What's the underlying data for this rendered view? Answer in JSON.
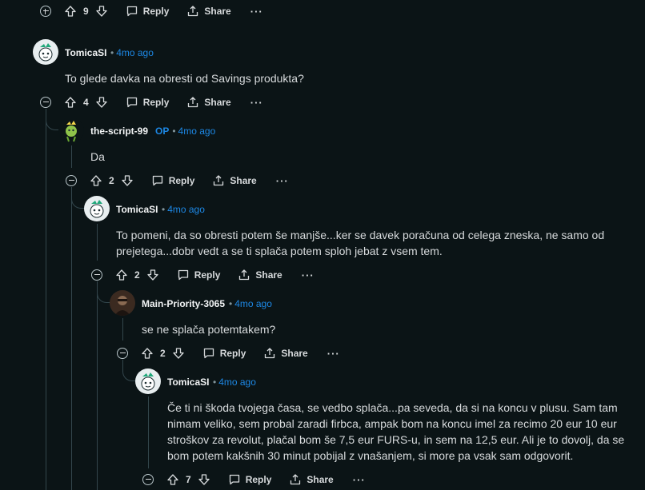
{
  "labels": {
    "reply": "Reply",
    "share": "Share",
    "more": "···",
    "op": "OP",
    "sep": "•"
  },
  "top_actions": {
    "votes": "9"
  },
  "comments": [
    {
      "user": "TomicaSI",
      "time": "4mo ago",
      "text": "To glede davka na obresti od Savings produkta?",
      "votes": "4"
    },
    {
      "user": "the-script-99",
      "time": "4mo ago",
      "text": "Da",
      "votes": "2"
    },
    {
      "user": "TomicaSI",
      "time": "4mo ago",
      "text": "To pomeni, da so obresti potem še manjše...ker se davek poračuna od celega zneska, ne samo od prejetega...dobr vedt a se ti splača potem sploh jebat z vsem tem.",
      "votes": "2"
    },
    {
      "user": "Main-Priority-3065",
      "time": "4mo ago",
      "text": "se ne splača potemtakem?",
      "votes": "2"
    },
    {
      "user": "TomicaSI",
      "time": "4mo ago",
      "text": "Če ti ni škoda tvojega časa, se vedbo splača...pa seveda, da si na koncu v plusu. Sam tam nimam veliko, sem probal zaradi firbca, ampak bom na koncu imel za recimo 20 eur 10 eur stroškov za revolut, plačal bom še 7,5 eur FURS-u, in sem na 12,5 eur. Ali je to dovolj, da se bom potem kakšnih 30 minut pobijal z vnašanjem, si more pa vsak sam odgovorit.",
      "votes": "7"
    }
  ]
}
